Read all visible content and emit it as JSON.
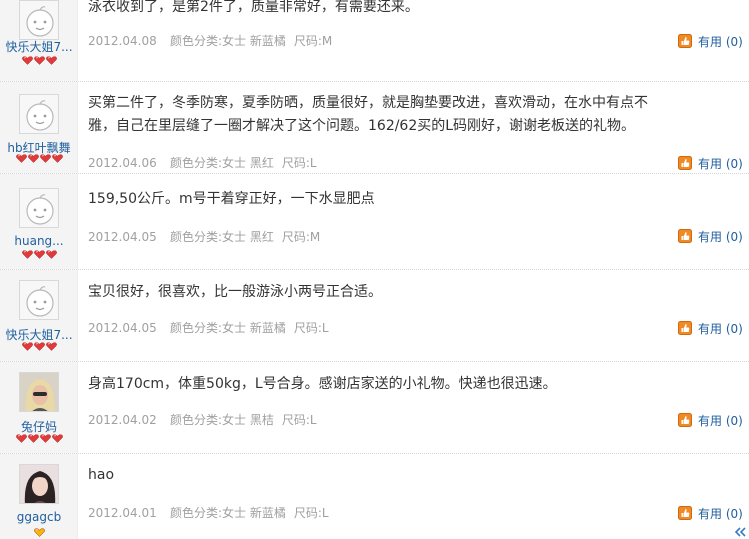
{
  "reviews": [
    {
      "user": "快乐大姐7...",
      "avatar": "default-baby-avatar",
      "rank_icon": "red-heart-icon",
      "rank_count": 3,
      "content": "泳衣收到了，是第2件了，质量非常好，有需要还来。",
      "date": "2012.04.08",
      "color_label": "颜色分类:",
      "color_value": "女士 新蓝橘",
      "size_label": "尺码:",
      "size_value": "M",
      "useful_label": "有用",
      "useful_count": "(0)"
    },
    {
      "user": "hb红叶飘舞",
      "avatar": "default-baby-avatar",
      "rank_icon": "red-heart-icon",
      "rank_count": 4,
      "content": "买第二件了，冬季防寒，夏季防晒，质量很好，就是胸垫要改进，喜欢滑动，在水中有点不雅，自己在里层缝了一圈才解决了这个问题。162/62买的L码刚好，谢谢老板送的礼物。",
      "date": "2012.04.06",
      "color_label": "颜色分类:",
      "color_value": "女士 黑红",
      "size_label": "尺码:",
      "size_value": "L",
      "useful_label": "有用",
      "useful_count": "(0)"
    },
    {
      "user": "huang...",
      "avatar": "default-baby-avatar",
      "rank_icon": "red-heart-icon",
      "rank_count": 3,
      "content": "159,50公斤。m号干着穿正好，一下水显肥点",
      "date": "2012.04.05",
      "color_label": "颜色分类:",
      "color_value": "女士 黑红",
      "size_label": "尺码:",
      "size_value": "M",
      "useful_label": "有用",
      "useful_count": "(0)"
    },
    {
      "user": "快乐大姐7...",
      "avatar": "default-baby-avatar",
      "rank_icon": "red-heart-icon",
      "rank_count": 3,
      "content": "宝贝很好，很喜欢，比一般游泳小两号正合适。",
      "date": "2012.04.05",
      "color_label": "颜色分类:",
      "color_value": "女士 新蓝橘",
      "size_label": "尺码:",
      "size_value": "L",
      "useful_label": "有用",
      "useful_count": "(0)"
    },
    {
      "user": "兔仔妈",
      "avatar": "blonde-woman-photo-avatar",
      "rank_icon": "red-heart-icon",
      "rank_count": 4,
      "content": "身高170cm，体重50kg，L号合身。感谢店家送的小礼物。快递也很迅速。",
      "date": "2012.04.02",
      "color_label": "颜色分类:",
      "color_value": "女士 黑桔",
      "size_label": "尺码:",
      "size_value": "L",
      "useful_label": "有用",
      "useful_count": "(0)"
    },
    {
      "user": "ggagcb",
      "avatar": "dark-hair-girl-photo-avatar",
      "rank_icon": "yellow-heart-icon",
      "rank_count": 1,
      "content": "hao",
      "date": "2012.04.01",
      "color_label": "颜色分类:",
      "color_value": "女士 新蓝橘",
      "size_label": "尺码:",
      "size_value": "L",
      "useful_label": "有用",
      "useful_count": "(0)"
    }
  ],
  "scroll_hint_icon": "double-chevron-left-icon",
  "colors": {
    "link_blue": "#1f5e9e",
    "meta_gray": "#a0a0a0",
    "useful_icon_orange": "#f08a24",
    "heart_red": "#e03a3a",
    "heart_yellow": "#f5b800"
  }
}
